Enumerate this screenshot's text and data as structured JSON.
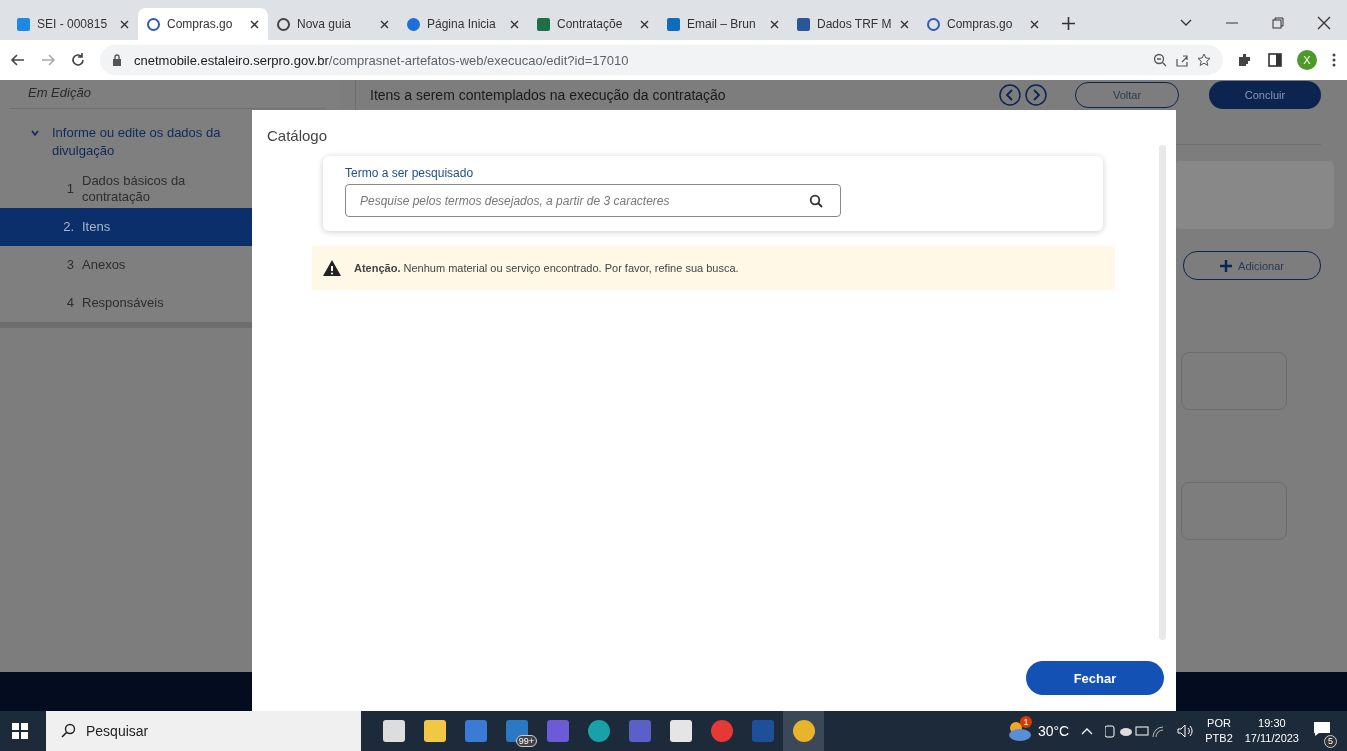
{
  "browser": {
    "tabs": [
      {
        "label": "SEI - 000815",
        "kind": "sei",
        "selected": false
      },
      {
        "label": "Compras.go",
        "kind": "compras",
        "selected": true
      },
      {
        "label": "Nova guia",
        "kind": "chrome",
        "selected": false
      },
      {
        "label": "Página Inicia",
        "kind": "cloud",
        "selected": false
      },
      {
        "label": "Contrataçõe",
        "kind": "excel",
        "selected": false
      },
      {
        "label": "Email – Brun",
        "kind": "outlook",
        "selected": false
      },
      {
        "label": "Dados TRF M",
        "kind": "word",
        "selected": false
      },
      {
        "label": "Compras.go",
        "kind": "compras",
        "selected": false
      }
    ],
    "url_host": "cnetmobile.estaleiro.serpro.gov.br",
    "url_path": "/comprasnet-artefatos-web/execucao/edit?id=17010",
    "profile_initial": "X"
  },
  "page": {
    "status": "Em Edição",
    "section": {
      "title": "Informe ou edite os dados da divulgação",
      "expanded": true,
      "items": [
        {
          "number": "1",
          "label": "Dados básicos da contratação",
          "selected": false
        },
        {
          "number": "2.",
          "label": "Itens",
          "selected": true
        },
        {
          "number": "3",
          "label": "Anexos",
          "selected": false
        },
        {
          "number": "4",
          "label": "Responsáveis",
          "selected": false
        }
      ]
    },
    "heading": "Itens a serem contemplados na execução da contratação",
    "back_button": "Voltar",
    "finish_button": "Concluir",
    "add_button": "Adicionar"
  },
  "dialog": {
    "title": "Catálogo",
    "search_label": "Termo a ser pesquisado",
    "search_placeholder": "Pesquise pelos termos desejados, a partir de 3 caracteres",
    "alert": "**Atenção.** Nenhum material ou serviço encontrado. Por favor, refine sua busca.",
    "close_button": "Fechar"
  },
  "taskbar": {
    "search_placeholder": "Pesquisar",
    "apps": [
      {
        "kind": "taskview",
        "active": false
      },
      {
        "kind": "folder",
        "active": false
      },
      {
        "kind": "store",
        "active": false
      },
      {
        "kind": "mail",
        "active": false,
        "badge": "99+"
      },
      {
        "kind": "copilot",
        "active": false
      },
      {
        "kind": "edge",
        "active": false
      },
      {
        "kind": "teams",
        "active": false
      },
      {
        "kind": "dapp",
        "active": false
      },
      {
        "kind": "gapp",
        "active": false
      },
      {
        "kind": "starapp",
        "active": false
      },
      {
        "kind": "chrome",
        "active": true
      }
    ],
    "weather_badge": "1",
    "temperature": "30°C",
    "language": "POR",
    "layout": "PTB2",
    "time": "19:30",
    "date": "17/11/2023",
    "notifications": "5"
  }
}
